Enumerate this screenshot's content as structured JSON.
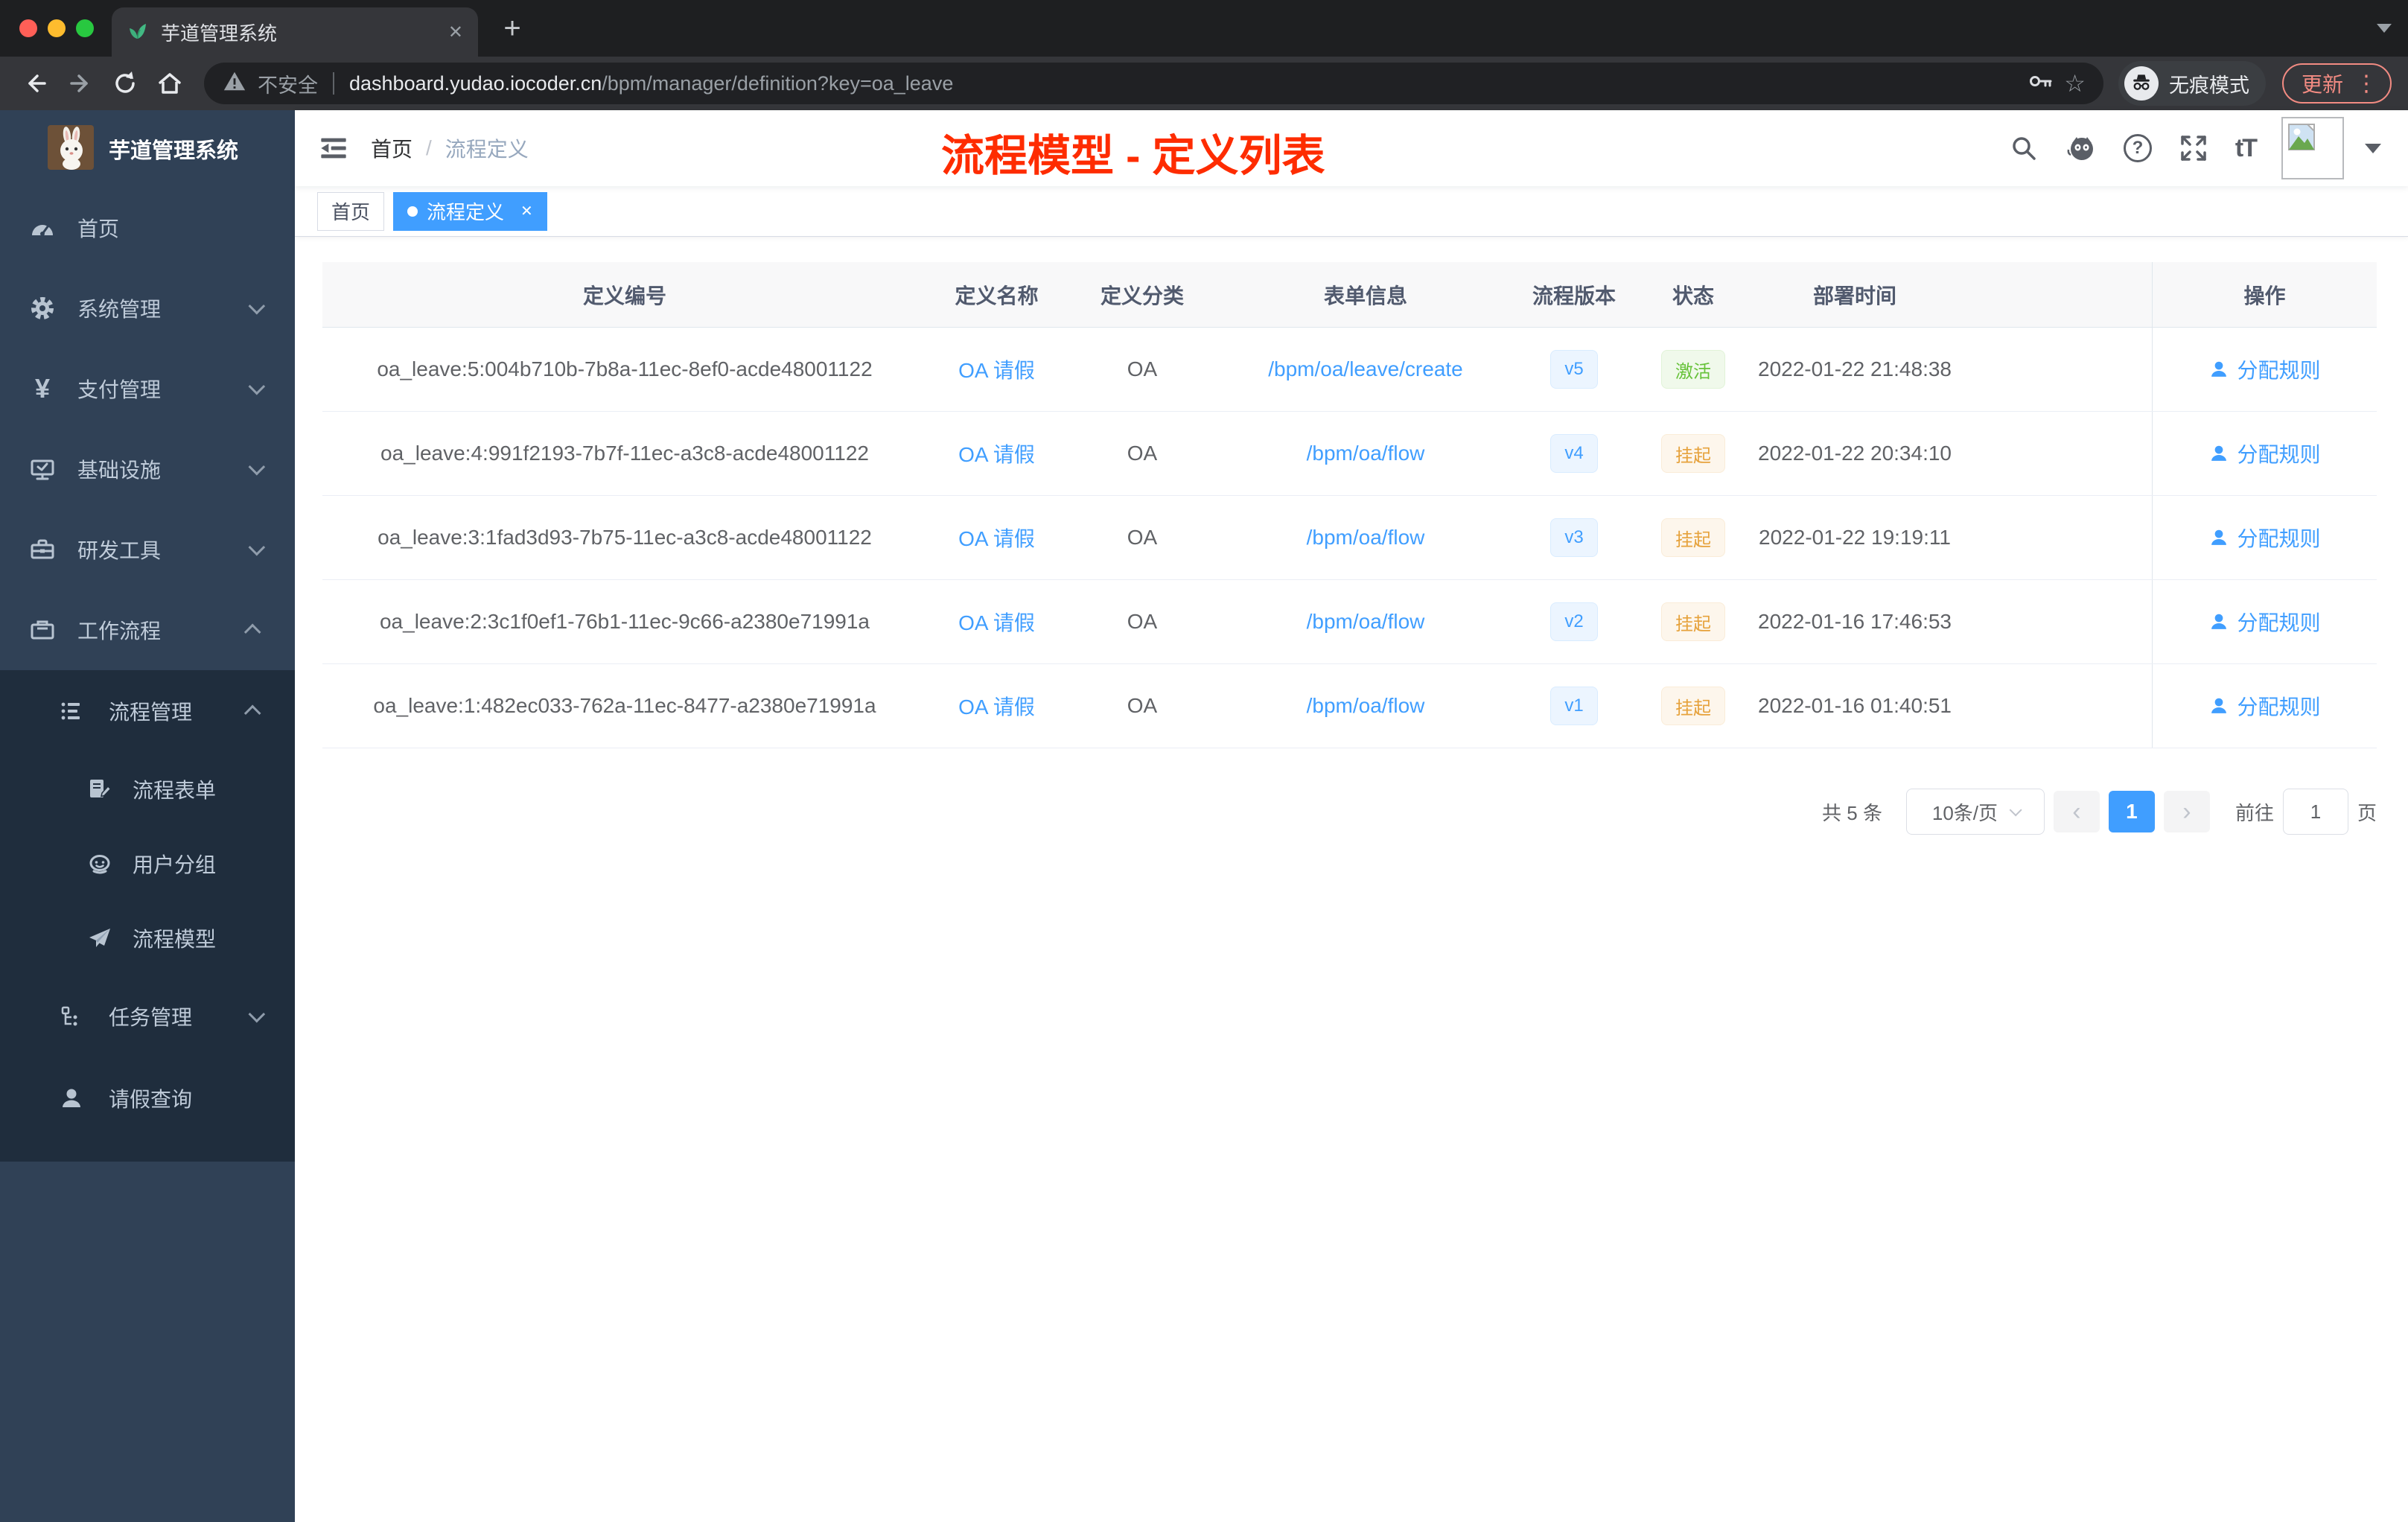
{
  "browser": {
    "tab_title": "芋道管理系统",
    "security_label": "不安全",
    "url_host": "dashboard.yudao.iocoder.cn",
    "url_path": "/bpm/manager/definition?key=oa_leave",
    "incognito_label": "无痕模式",
    "update_label": "更新"
  },
  "glyphs": {
    "close": "✕",
    "plus": "+",
    "kebab": "⋮",
    "star": "☆",
    "question": "?",
    "font_size": "tT",
    "breadcrumb_sep": "/",
    "page_prev": "‹",
    "page_next": "›"
  },
  "sidebar": {
    "app_title": "芋道管理系统",
    "items": [
      {
        "label": "首页"
      },
      {
        "label": "系统管理"
      },
      {
        "label": "支付管理"
      },
      {
        "label": "基础设施"
      },
      {
        "label": "研发工具"
      },
      {
        "label": "工作流程"
      }
    ],
    "submenu": {
      "items": [
        {
          "label": "流程管理"
        },
        {
          "label": "任务管理"
        },
        {
          "label": "请假查询"
        }
      ],
      "children": [
        {
          "label": "流程表单"
        },
        {
          "label": "用户分组"
        },
        {
          "label": "流程模型"
        }
      ]
    }
  },
  "header": {
    "breadcrumb": [
      {
        "label": "首页"
      },
      {
        "label": "流程定义"
      }
    ],
    "annotation": "流程模型 - 定义列表"
  },
  "tags": [
    {
      "label": "首页"
    },
    {
      "label": "流程定义"
    }
  ],
  "table": {
    "columns": [
      "定义编号",
      "定义名称",
      "定义分类",
      "表单信息",
      "流程版本",
      "状态",
      "部署时间",
      "操作"
    ],
    "action_label": "分配规则",
    "rows": [
      {
        "id": "oa_leave:5:004b710b-7b8a-11ec-8ef0-acde48001122",
        "name": "OA 请假",
        "category": "OA",
        "form": "/bpm/oa/leave/create",
        "version": "v5",
        "status": "激活",
        "time": "2022-01-22 21:48:38"
      },
      {
        "id": "oa_leave:4:991f2193-7b7f-11ec-a3c8-acde48001122",
        "name": "OA 请假",
        "category": "OA",
        "form": "/bpm/oa/flow",
        "version": "v4",
        "status": "挂起",
        "time": "2022-01-22 20:34:10"
      },
      {
        "id": "oa_leave:3:1fad3d93-7b75-11ec-a3c8-acde48001122",
        "name": "OA 请假",
        "category": "OA",
        "form": "/bpm/oa/flow",
        "version": "v3",
        "status": "挂起",
        "time": "2022-01-22 19:19:11"
      },
      {
        "id": "oa_leave:2:3c1f0ef1-76b1-11ec-9c66-a2380e71991a",
        "name": "OA 请假",
        "category": "OA",
        "form": "/bpm/oa/flow",
        "version": "v2",
        "status": "挂起",
        "time": "2022-01-16 17:46:53"
      },
      {
        "id": "oa_leave:1:482ec033-762a-11ec-8477-a2380e71991a",
        "name": "OA 请假",
        "category": "OA",
        "form": "/bpm/oa/flow",
        "version": "v1",
        "status": "挂起",
        "time": "2022-01-16 01:40:51"
      }
    ]
  },
  "pagination": {
    "total": "共 5 条",
    "page_size": "10条/页",
    "page": "1",
    "goto_label": "前往",
    "goto_value": "1",
    "page_unit": "页"
  },
  "colors": {
    "accent": "#409eff",
    "annotation_red": "#fe2c00",
    "status_active_green": "#67c23a",
    "status_suspend_orange": "#e6a23c",
    "sidebar_bg": "#304156",
    "submenu_bg": "#1f2d3d"
  }
}
